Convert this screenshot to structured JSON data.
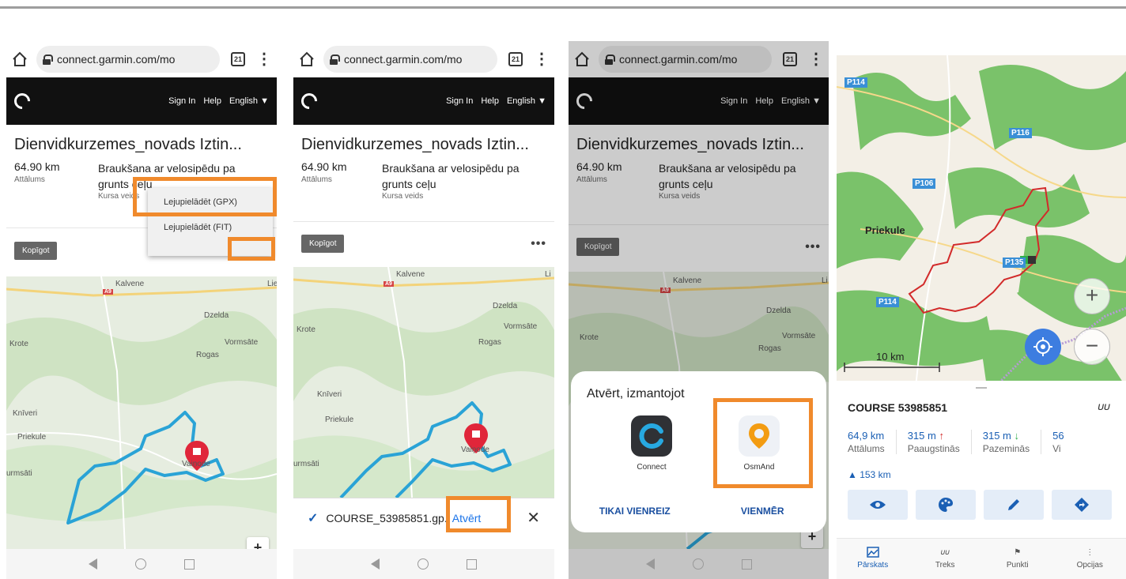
{
  "browser": {
    "url": "connect.garmin.com/mo",
    "tab_count": "21"
  },
  "garmin": {
    "nav": {
      "sign_in": "Sign In",
      "help": "Help",
      "language": "English ▼"
    },
    "course_title": "Dienvidkurzemes_novads Iztin...",
    "distance_value": "64.90 km",
    "distance_label": "Attālums",
    "type_value_line1": "Braukšana ar velosipēdu pa",
    "type_value_line2": "grunts ceļu",
    "type_label": "Kursa veids",
    "share_button": "Kopīgot",
    "more_dots": "•••"
  },
  "dropdown": {
    "items": [
      "Lejupielādēt (GPX)",
      "Lejupielādēt (FIT)"
    ]
  },
  "map": {
    "labels": [
      "Kalvene",
      "Dzelda",
      "Krote",
      "Vormsāte",
      "Rogas",
      "Knīveri",
      "Priekule",
      "Vaiņode",
      "urmsāti",
      "A9",
      "Lie",
      "Li"
    ]
  },
  "download_bar": {
    "filename": "COURSE_53985851.gp",
    "open_label": "Atvērt",
    "ellipsis": "."
  },
  "open_with": {
    "title": "Atvērt, izmantojot",
    "apps": [
      "Connect",
      "OsmAnd"
    ],
    "just_once": "TIKAI VIENREIZ",
    "always": "VIENMĒR"
  },
  "osmand": {
    "map_labels": {
      "p114_top": "P114",
      "p116": "P116",
      "p106": "P106",
      "priekule": "Priekule",
      "p135": "P135",
      "p114_low": "P114",
      "scale": "10 km"
    },
    "course_title": "COURSE 53985851",
    "stats": [
      {
        "value": "64,9 km",
        "label": "Attālums"
      },
      {
        "value": "315 m",
        "label": "Paaugstinās"
      },
      {
        "value": "315 m",
        "label": "Pazeminās"
      },
      {
        "value": "56",
        "label": "Vi"
      }
    ],
    "total_distance": "▲ 153 km",
    "tabs": [
      "Pārskats",
      "Treks",
      "Punkti",
      "Opcijas"
    ],
    "colors": {
      "accent": "#1a5fb4",
      "route": "#d22a2a",
      "forest": "#7ac26a",
      "highlight": "#f08a2c"
    }
  }
}
